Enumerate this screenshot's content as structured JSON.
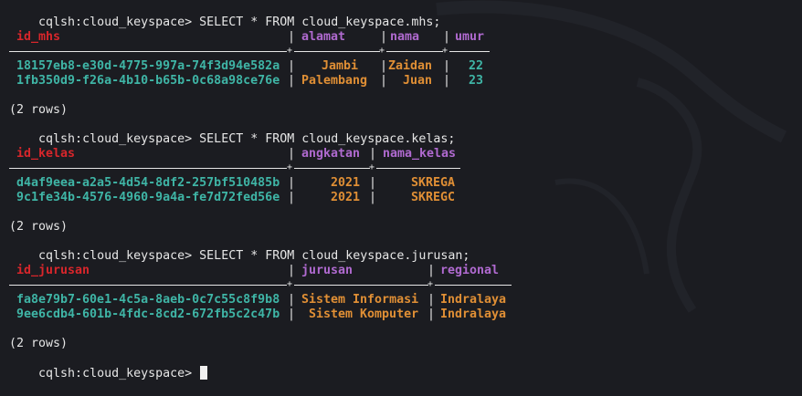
{
  "prompt": "cqlsh:cloud_keyspace>",
  "queries": [
    {
      "command": "SELECT * FROM cloud_keyspace.mhs;",
      "columns": [
        "id_mhs",
        "alamat",
        "nama",
        "umur"
      ],
      "rows": [
        [
          "18157eb8-e30d-4775-997a-74f3d94e582a",
          "Jambi",
          "Zaidan",
          "22"
        ],
        [
          "1fb350d9-f26a-4b10-b65b-0c68a98ce76e",
          "Palembang",
          "Juan",
          "23"
        ]
      ],
      "row_count": "(2 rows)"
    },
    {
      "command": "SELECT * FROM cloud_keyspace.kelas;",
      "columns": [
        "id_kelas",
        "angkatan",
        "nama_kelas"
      ],
      "rows": [
        [
          "d4af9eea-a2a5-4d54-8df2-257bf510485b",
          "2021",
          "SKREGA"
        ],
        [
          "9c1fe34b-4576-4960-9a4a-fe7d72fed56e",
          "2021",
          "SKREGC"
        ]
      ],
      "row_count": "(2 rows)"
    },
    {
      "command": "SELECT * FROM cloud_keyspace.jurusan;",
      "columns": [
        "id_jurusan",
        "jurusan",
        "regional"
      ],
      "rows": [
        [
          "fa8e79b7-60e1-4c5a-8aeb-0c7c55c8f9b8",
          "Sistem Informasi",
          "Indralaya"
        ],
        [
          "9ee6cdb4-601b-4fdc-8cd2-672fb5c2c47b",
          "Sistem Komputer",
          "Indralaya"
        ]
      ],
      "row_count": "(2 rows)"
    }
  ],
  "colors": {
    "background": "#1b1c21",
    "key_header": "#d8262b",
    "column_header": "#b06ad0",
    "key_value": "#3fb5a6",
    "value": "#e08f35",
    "text": "#e6e6e6"
  }
}
